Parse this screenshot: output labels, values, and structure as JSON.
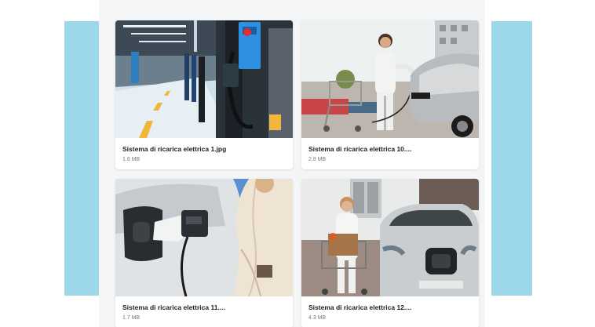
{
  "files": [
    {
      "name": "Sistema di ricarica elettrica 1.jpg",
      "size": "1.6 MB",
      "image": "ev-charging-station-garage"
    },
    {
      "name": "Sistema di ricarica elettrica 10....",
      "size": "2.8 MB",
      "image": "woman-charging-car-with-shopping-cart"
    },
    {
      "name": "Sistema di ricarica elettrica 11....",
      "size": "1.7 MB",
      "image": "charging-plug-in-car-port"
    },
    {
      "name": "Sistema di ricarica elettrica 12....",
      "size": "4.3 MB",
      "image": "woman-with-cart-next-to-electric-car"
    }
  ],
  "colors": {
    "side_panel": "#9dd8ea",
    "gallery_bg": "#f4f5f7",
    "card_bg": "#ffffff"
  }
}
